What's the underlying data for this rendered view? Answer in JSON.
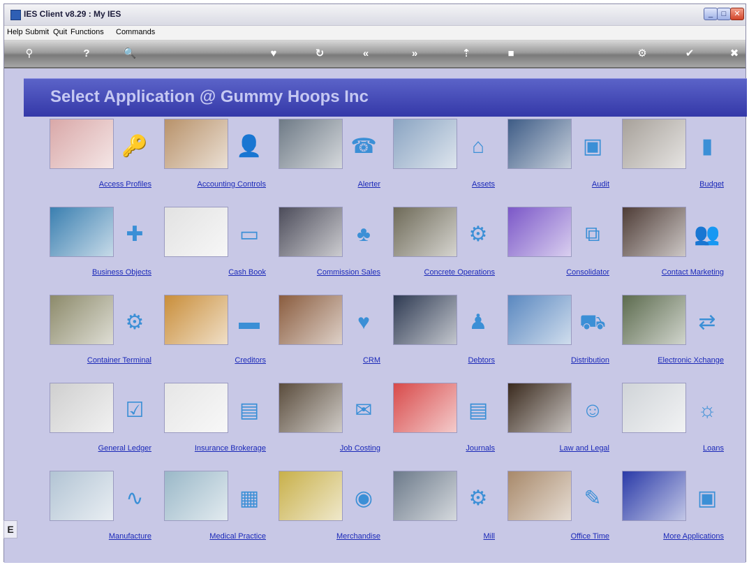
{
  "window": {
    "title": "IES Client v8.29 : My IES"
  },
  "menu": [
    "Help",
    "Submit",
    "Quit",
    "Functions",
    "Commands"
  ],
  "toolbar": [
    {
      "icon": "key-icon",
      "glyph": "⚲"
    },
    {
      "icon": "help-icon",
      "glyph": "?"
    },
    {
      "icon": "search-icon",
      "glyph": "🔍"
    },
    {
      "icon": "heart-icon",
      "glyph": "♥"
    },
    {
      "icon": "refresh-icon",
      "glyph": "↻"
    },
    {
      "icon": "first-icon",
      "glyph": "«"
    },
    {
      "icon": "last-icon",
      "glyph": "»"
    },
    {
      "icon": "up-icon",
      "glyph": "⇡"
    },
    {
      "icon": "stop-icon",
      "glyph": "■"
    },
    {
      "icon": "settings-icon",
      "glyph": "⚙"
    },
    {
      "icon": "check-icon",
      "glyph": "✔"
    },
    {
      "icon": "close-icon",
      "glyph": "✖"
    }
  ],
  "page": {
    "title": "Select Application @ Gummy Hoops Inc"
  },
  "side_tab": "E",
  "apps": [
    {
      "label": "Access Profiles",
      "icon": "key-icon",
      "glyph": "🔑",
      "photo": "#d9a8a8"
    },
    {
      "label": "Accounting Controls",
      "icon": "user-chat-icon",
      "glyph": "👤",
      "photo": "#b8926a"
    },
    {
      "label": "Alerter",
      "icon": "phone-icon",
      "glyph": "☎",
      "photo": "#6e7a86"
    },
    {
      "label": "Assets",
      "icon": "home-icon",
      "glyph": "⌂",
      "photo": "#8aa4c2"
    },
    {
      "label": "Audit",
      "icon": "monitor-icon",
      "glyph": "▣",
      "photo": "#3e5c86"
    },
    {
      "label": "Budget",
      "icon": "bar-chart-icon",
      "glyph": "▮",
      "photo": "#a7a19a"
    },
    {
      "label": "Business Objects",
      "icon": "puzzle-icon",
      "glyph": "✚",
      "photo": "#3a7fb0"
    },
    {
      "label": "Cash Book",
      "icon": "card-icon",
      "glyph": "▭",
      "photo": "#e2e2e2"
    },
    {
      "label": "Commission Sales",
      "icon": "sales-icon",
      "glyph": "♣",
      "photo": "#4c4c5a"
    },
    {
      "label": "Concrete Operations",
      "icon": "gears-icon",
      "glyph": "⚙",
      "photo": "#6e6a58"
    },
    {
      "label": "Consolidator",
      "icon": "hierarchy-icon",
      "glyph": "⧉",
      "photo": "#7b57c8"
    },
    {
      "label": "Contact Marketing",
      "icon": "people-icon",
      "glyph": "👥",
      "photo": "#4e3c36"
    },
    {
      "label": "Container Terminal",
      "icon": "gears-icon",
      "glyph": "⚙",
      "photo": "#8c8a6a"
    },
    {
      "label": "Creditors",
      "icon": "card-icon",
      "glyph": "▬",
      "photo": "#c98e3a"
    },
    {
      "label": "CRM",
      "icon": "heart-icon",
      "glyph": "♥",
      "photo": "#8a5c3e"
    },
    {
      "label": "Debtors",
      "icon": "people-icon",
      "glyph": "♟",
      "photo": "#2e3a52"
    },
    {
      "label": "Distribution",
      "icon": "truck-icon",
      "glyph": "⛟",
      "photo": "#5a88c0"
    },
    {
      "label": "Electronic Xchange",
      "icon": "exchange-icon",
      "glyph": "⇄",
      "photo": "#5c6b4e"
    },
    {
      "label": "General Ledger",
      "icon": "checklist-icon",
      "glyph": "☑",
      "photo": "#cfcfcf"
    },
    {
      "label": "Insurance Brokerage",
      "icon": "cards-icon",
      "glyph": "▤",
      "photo": "#e6e6e6"
    },
    {
      "label": "Job Costing",
      "icon": "chat-icon",
      "glyph": "✉",
      "photo": "#5a4c3c"
    },
    {
      "label": "Journals",
      "icon": "document-icon",
      "glyph": "▤",
      "photo": "#d84a4a"
    },
    {
      "label": "Law and Legal",
      "icon": "users-icon",
      "glyph": "☺",
      "photo": "#3a2a1e"
    },
    {
      "label": "Loans",
      "icon": "hands-icon",
      "glyph": "☼",
      "photo": "#d0d4d8"
    },
    {
      "label": "Manufacture",
      "icon": "pulse-icon",
      "glyph": "∿",
      "photo": "#b2c4d4"
    },
    {
      "label": "Medical Practice",
      "icon": "gallery-icon",
      "glyph": "▦",
      "photo": "#9ab8c8"
    },
    {
      "label": "Merchandise",
      "icon": "globe-icon",
      "glyph": "◉",
      "photo": "#c8b04a"
    },
    {
      "label": "Mill",
      "icon": "gears-icon",
      "glyph": "⚙",
      "photo": "#6c7a8a"
    },
    {
      "label": "Office Time",
      "icon": "people-icon",
      "glyph": "✎",
      "photo": "#a8896a"
    },
    {
      "label": "More Applications",
      "icon": "monitor-icon",
      "glyph": "▣",
      "photo": "#2a3aa8"
    }
  ]
}
